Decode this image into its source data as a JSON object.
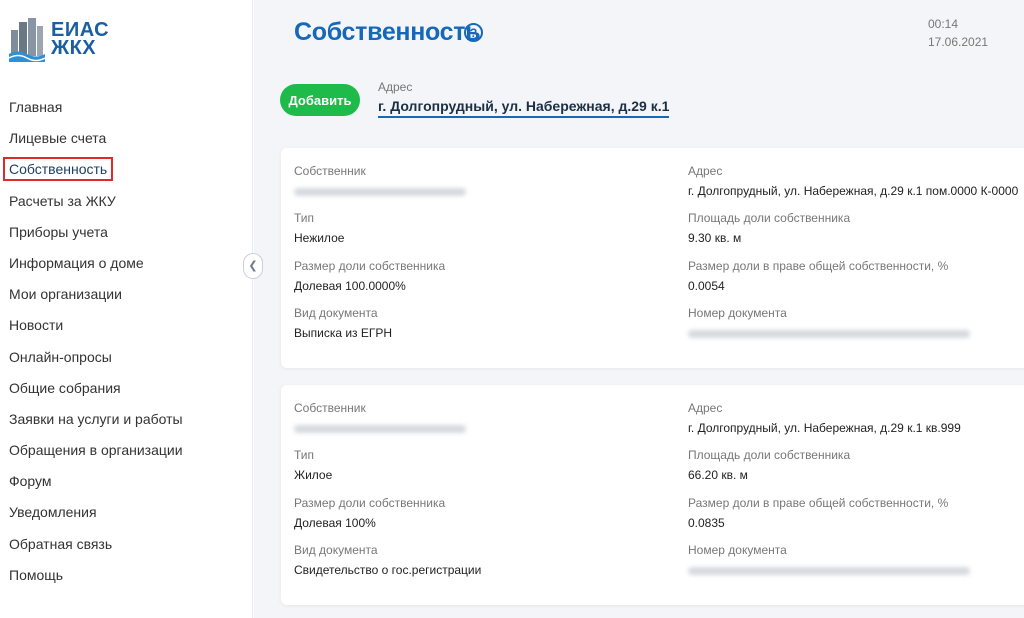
{
  "logo": {
    "line1": "ЕИАС",
    "line2": "ЖКХ",
    "color": "#1b5fa3"
  },
  "nav": [
    {
      "label": "Главная"
    },
    {
      "label": "Лицевые счета"
    },
    {
      "label": "Собственность",
      "active": true
    },
    {
      "label": "Расчеты за ЖКУ"
    },
    {
      "label": "Приборы учета"
    },
    {
      "label": "Информация о доме"
    },
    {
      "label": "Мои организации"
    },
    {
      "label": "Новости"
    },
    {
      "label": "Онлайн-опросы"
    },
    {
      "label": "Общие собрания"
    },
    {
      "label": "Заявки на услуги и работы"
    },
    {
      "label": "Обращения в организации"
    },
    {
      "label": "Форум"
    },
    {
      "label": "Уведомления"
    },
    {
      "label": "Обратная связь"
    },
    {
      "label": "Помощь"
    }
  ],
  "header": {
    "title": "Собственность",
    "help_icon": "?",
    "time": "00:14",
    "date": "17.06.2021"
  },
  "toolbar": {
    "add_label": "Добавить",
    "address_label": "Адрес",
    "address_value": "г. Долгопрудный, ул. Набережная, д.29 к.1"
  },
  "labels": {
    "owner": "Собственник",
    "type": "Тип",
    "share_size": "Размер доли собственника",
    "doc_type": "Вид документа",
    "address": "Адрес",
    "share_area": "Площадь доли собственника",
    "share_common": "Размер доли в праве общей собственности, %",
    "doc_number": "Номер документа"
  },
  "properties": [
    {
      "type": "Нежилое",
      "share_size": "Долевая 100.0000%",
      "doc_type": "Выписка из ЕГРН",
      "address": "г. Долгопрудный, ул. Набережная, д.29 к.1 пом.0000 К-0000",
      "share_area": "9.30 кв. м",
      "share_common": "0.0054"
    },
    {
      "type": "Жилое",
      "share_size": "Долевая 100%",
      "doc_type": "Свидетельство о гос.регистрации",
      "address": "г. Долгопрудный, ул. Набережная, д.29 к.1 кв.999",
      "share_area": "66.20 кв. м",
      "share_common": "0.0835"
    }
  ],
  "colors": {
    "accent": "#1669b8",
    "add_button": "#1ebb4a",
    "active_outline": "#e02a2a"
  }
}
